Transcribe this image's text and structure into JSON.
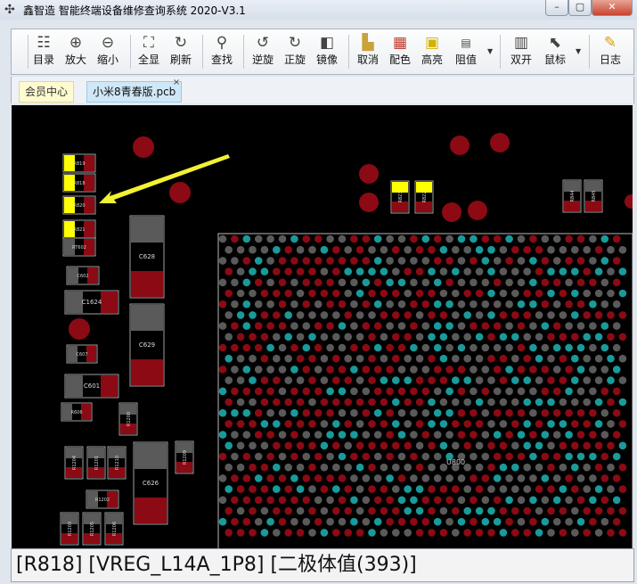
{
  "window": {
    "title": "鑫智造 智能终端设备维修查询系统 2020-V3.1",
    "controls": [
      "–",
      "▢",
      "✕"
    ]
  },
  "toolbar": {
    "buttons": [
      {
        "label": "目录",
        "icon": "catalog-icon"
      },
      {
        "label": "放大",
        "icon": "zoom-in-icon"
      },
      {
        "label": "缩小",
        "icon": "zoom-out-icon"
      },
      {
        "label": "全显",
        "icon": "fit-all-icon"
      },
      {
        "label": "刷新",
        "icon": "refresh-icon"
      },
      {
        "label": "查找",
        "icon": "search-icon"
      },
      {
        "label": "逆旋",
        "icon": "rotate-ccw-icon"
      },
      {
        "label": "正旋",
        "icon": "rotate-cw-icon"
      },
      {
        "label": "镜像",
        "icon": "mirror-icon"
      },
      {
        "label": "取消",
        "icon": "clear-icon"
      },
      {
        "label": "配色",
        "icon": "palette-icon"
      },
      {
        "label": "高亮",
        "icon": "highlight-icon"
      },
      {
        "label": "阻值",
        "icon": "resistance-icon"
      },
      {
        "label": "双开",
        "icon": "dual-view-icon"
      },
      {
        "label": "鼠标",
        "icon": "mouse-icon"
      },
      {
        "label": "日志",
        "icon": "log-icon"
      }
    ]
  },
  "tabs": [
    {
      "label": "会员中心"
    },
    {
      "label": "小米8青春版.pcb",
      "close": "×"
    }
  ],
  "pcb": {
    "components": [
      "R819",
      "R818",
      "R820",
      "R821",
      "RT602",
      "C602",
      "C1624",
      "C628",
      "C629",
      "C607",
      "C601",
      "R606",
      "R1200",
      "R1204",
      "R1201",
      "R1210",
      "C626",
      "R1202",
      "R1203",
      "R1205",
      "R1206",
      "R1209",
      "R823",
      "R822",
      "R844",
      "R845"
    ],
    "bga_label": "U800",
    "colors": {
      "background": "#000000",
      "pad_red": "#8b0a14",
      "pad_gray": "#5a5a5a",
      "pad_teal": "#1a9a9a",
      "highlight": "#ffff00",
      "arrow": "#f2f233"
    }
  },
  "status": {
    "text": "[R818] [VREG_L14A_1P8] [二极体值(393)]"
  }
}
